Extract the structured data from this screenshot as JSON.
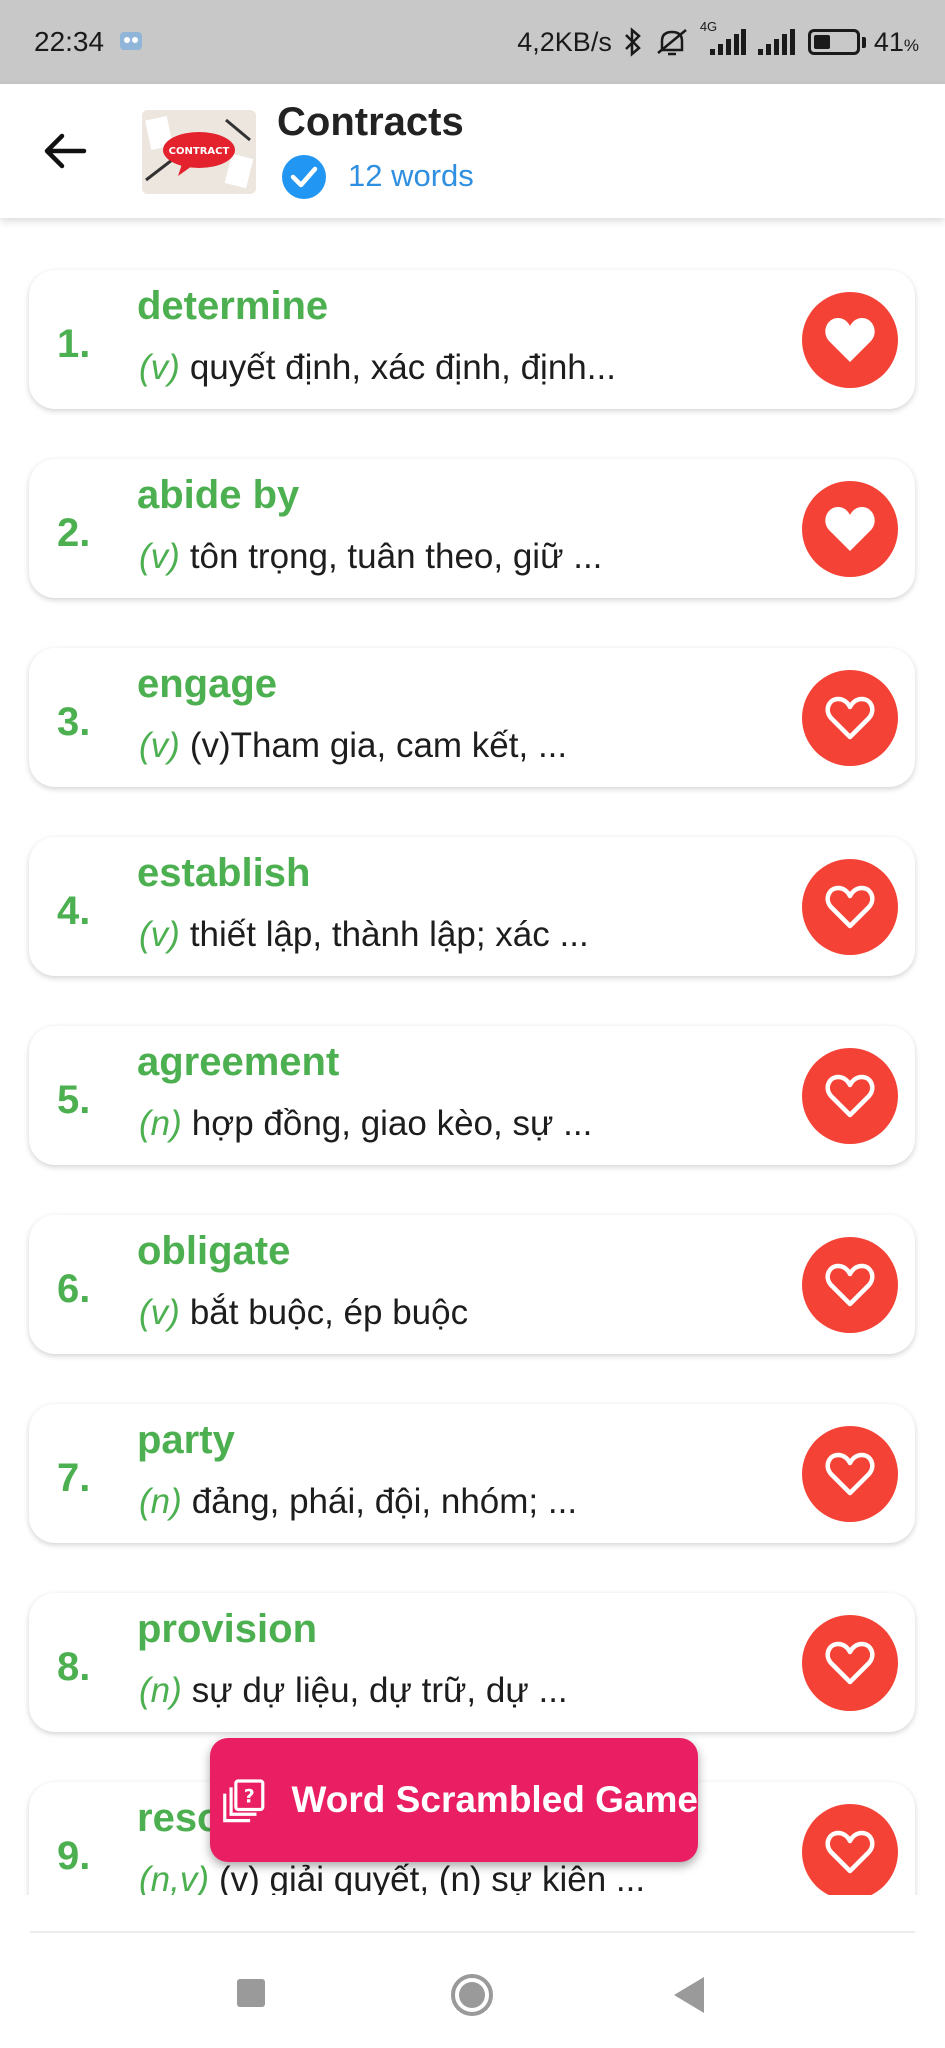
{
  "status_bar": {
    "time": "22:34",
    "network_speed": "4,2KB/s",
    "network_type": "4G",
    "battery_percent": "41",
    "battery_unit": "%",
    "battery_level": 0.41
  },
  "header": {
    "title": "Contracts",
    "thumbnail_text": "CONTRACT",
    "word_count": "12 words"
  },
  "words": [
    {
      "index": "1.",
      "word": "determine",
      "pos": "(v)",
      "meaning": "quyết định, xác định, định...",
      "favorited": true
    },
    {
      "index": "2.",
      "word": "abide by",
      "pos": "(v)",
      "meaning": "tôn trọng, tuân theo, giữ ...",
      "favorited": true
    },
    {
      "index": "3.",
      "word": "engage",
      "pos": "(v)",
      "meaning": "(v)Tham gia, cam kết, ...",
      "favorited": false
    },
    {
      "index": "4.",
      "word": "establish",
      "pos": "(v)",
      "meaning": "thiết lập, thành lập; xác ...",
      "favorited": false
    },
    {
      "index": "5.",
      "word": "agreement",
      "pos": "(n)",
      "meaning": "hợp đồng, giao kèo, sự ...",
      "favorited": false
    },
    {
      "index": "6.",
      "word": "obligate",
      "pos": "(v)",
      "meaning": "bắt buộc, ép buộc",
      "favorited": false
    },
    {
      "index": "7.",
      "word": "party",
      "pos": "(n)",
      "meaning": "đảng, phái, đội, nhóm; ...",
      "favorited": false
    },
    {
      "index": "8.",
      "word": "provision",
      "pos": "(n)",
      "meaning": "sự dự liệu, dự trữ, dự ...",
      "favorited": false
    },
    {
      "index": "9.",
      "word": "resolve",
      "pos": "(n,v)",
      "meaning": "(v) giải quyết, (n) sự kiên ...",
      "favorited": false
    }
  ],
  "game_button": {
    "label": "Word Scrambled Game"
  },
  "colors": {
    "accent_green": "#4caf50",
    "heart_red": "#f44336",
    "fab_pink": "#e91e63",
    "verified_blue": "#2196f3"
  }
}
